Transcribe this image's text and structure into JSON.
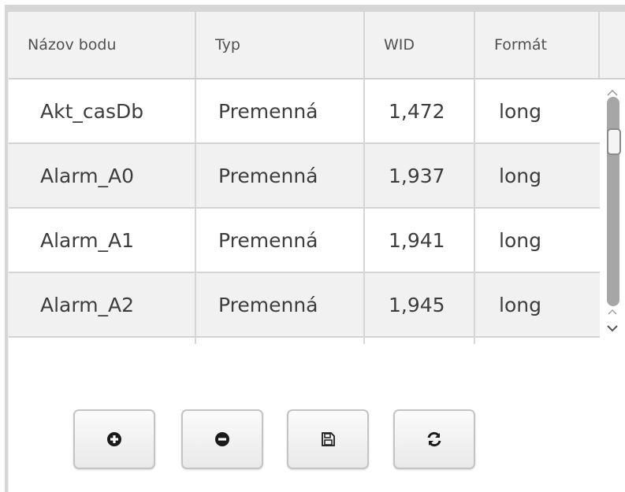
{
  "table": {
    "columns": [
      "Názov bodu",
      "Typ",
      "WID",
      "Formát",
      ""
    ],
    "rows": [
      {
        "name": "Akt_casDb",
        "type": "Premenná",
        "wid": "1,472",
        "format": "long"
      },
      {
        "name": "Alarm_A0",
        "type": "Premenná",
        "wid": "1,937",
        "format": "long"
      },
      {
        "name": "Alarm_A1",
        "type": "Premenná",
        "wid": "1,941",
        "format": "long"
      },
      {
        "name": "Alarm_A2",
        "type": "Premenná",
        "wid": "1,945",
        "format": "long"
      }
    ]
  },
  "icons": {
    "scroll_up": "chevron-up-icon",
    "scroll_down": "chevron-down-icon",
    "add": "plus-circle-icon",
    "remove": "minus-circle-icon",
    "save": "floppy-disk-icon",
    "refresh": "refresh-icon"
  },
  "colors": {
    "header_bg": "#f2f2f2",
    "alt_row_bg": "#f1f1f1",
    "grid_line": "#d6d6d6",
    "text": "#3d3d3d"
  }
}
